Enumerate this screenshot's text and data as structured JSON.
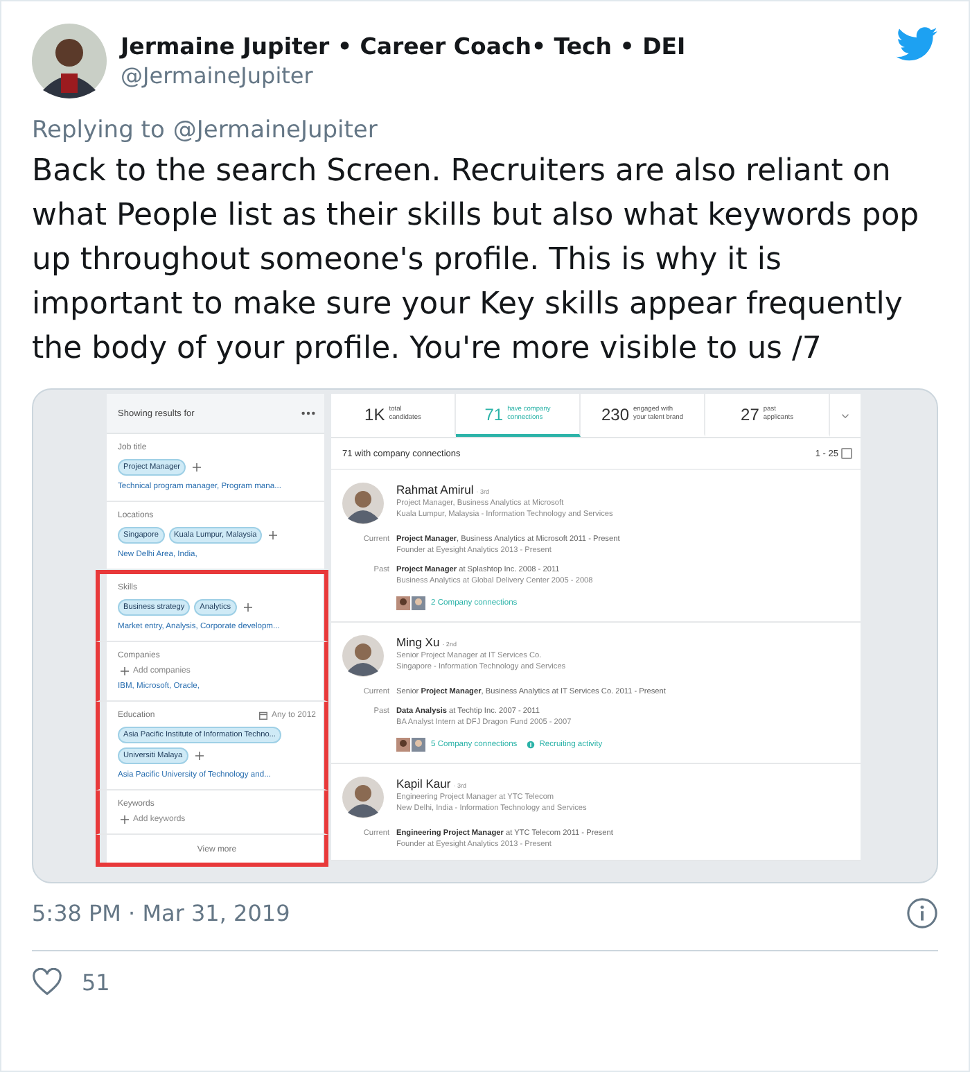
{
  "tweet": {
    "author_name": "Jermaine Jupiter • Career Coach• Tech • DEI",
    "handle": "@JermaineJupiter",
    "replying_label": "Replying to",
    "replying_handle": "@JermaineJupiter",
    "text": "Back to the search Screen. Recruiters are also reliant on what People list as their skills but also what keywords pop up throughout someone's profile. This is why it is important to make sure your Key skills appear frequently the body of your profile. You're more visible to us /7",
    "timestamp": "5:38 PM · Mar 31, 2019",
    "likes": "51"
  },
  "embedded_screenshot": {
    "filter_panel": {
      "title": "Showing results for",
      "sections": [
        {
          "label": "Job title",
          "tags": [
            "Project Manager"
          ],
          "suggestions": "Technical program manager, Program mana...",
          "highlighted": false
        },
        {
          "label": "Locations",
          "tags": [
            "Singapore",
            "Kuala Lumpur, Malaysia"
          ],
          "suggestions": "New Delhi Area, India,",
          "highlighted": false
        },
        {
          "label": "Skills",
          "tags": [
            "Business strategy",
            "Analytics"
          ],
          "suggestions": "Market entry, Analysis, Corporate developm...",
          "highlighted": true
        },
        {
          "label": "Companies",
          "add_label": "Add companies",
          "suggestions": "IBM, Microsoft, Oracle,",
          "highlighted": true
        },
        {
          "label": "Education",
          "range": "Any to 2012",
          "tags": [
            "Asia Pacific Institute of Information Techno...",
            "Universiti Malaya"
          ],
          "suggestions": "Asia Pacific University of Technology and...",
          "highlighted": true
        },
        {
          "label": "Keywords",
          "add_label": "Add keywords",
          "highlighted": true
        }
      ],
      "view_more": "View more"
    },
    "tabs": [
      {
        "count": "1K",
        "label_lines": [
          "total",
          "candidates"
        ],
        "selected": false
      },
      {
        "count": "71",
        "label_lines": [
          "have company",
          "connections"
        ],
        "selected": true
      },
      {
        "count": "230",
        "label_lines": [
          "engaged with",
          "your talent brand"
        ],
        "selected": false
      },
      {
        "count": "27",
        "label_lines": [
          "past",
          "applicants"
        ],
        "selected": false
      }
    ],
    "results_title": "71 with company connections",
    "results_range": "1 - 25",
    "select_all_checked": false,
    "candidates": [
      {
        "name": "Rahmat Amirul",
        "degree": "· 3rd",
        "headline": "Project Manager, Business Analytics at Microsoft",
        "location": "Kuala Lumpur, Malaysia - Information Technology and Services",
        "experience": [
          {
            "label": "Current",
            "lines": [
              "**Project Manager**, Business Analytics at Microsoft 2011 - Present",
              "Founder at Eyesight Analytics 2013 - Present"
            ]
          },
          {
            "label": "Past",
            "lines": [
              "**Project Manager** at Splashtop Inc. 2008 - 2011",
              "Business Analytics at Global Delivery Center 2005 - 2008"
            ]
          }
        ],
        "connections": "2 Company connections"
      },
      {
        "name": "Ming Xu",
        "degree": "· 2nd",
        "headline": "Senior Project Manager at IT Services Co.",
        "location": "Singapore - Information Technology and Services",
        "experience": [
          {
            "label": "Current",
            "lines": [
              "Senior **Project Manager**, Business Analytics at IT Services Co. 2011 - Present"
            ]
          },
          {
            "label": "Past",
            "lines": [
              "**Data Analysis** at Techtip Inc. 2007 - 2011",
              "BA Analyst Intern at DFJ Dragon Fund 2005 - 2007"
            ]
          }
        ],
        "connections": "5 Company connections",
        "recruiting_activity": "Recruiting activity"
      },
      {
        "name": "Kapil Kaur",
        "degree": "· 3rd",
        "headline": "Engineering Project Manager at YTC Telecom",
        "location": "New Delhi, India - Information Technology and Services",
        "experience": [
          {
            "label": "Current",
            "lines": [
              "**Engineering Project Manager** at YTC Telecom 2011 - Present",
              "Founder at Eyesight Analytics 2013 - Present"
            ]
          }
        ]
      }
    ]
  }
}
